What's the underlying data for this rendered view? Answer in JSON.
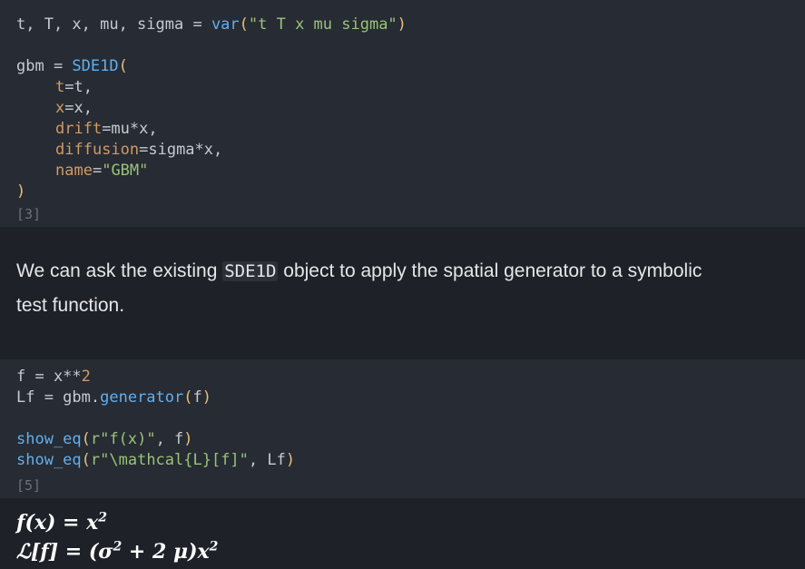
{
  "cell1": {
    "counter": "[3]",
    "line1_lhs": "t, T, x, mu, sigma = ",
    "line1_fn": "var",
    "line1_open": "(",
    "line1_str": "\"t T x mu sigma\"",
    "line1_close": ")",
    "line3_lhs": "gbm = ",
    "line3_fn": "SDE1D",
    "line3_open": "(",
    "line4_kw": "t",
    "line4_rest": "=t,",
    "line5_kw": "x",
    "line5_rest": "=x,",
    "line6_kw": "drift",
    "line6_rest": "=mu*x,",
    "line7_kw": "diffusion",
    "line7_rest": "=sigma*x,",
    "line8_kw": "name",
    "line8_eq": "=",
    "line8_str": "\"GBM\"",
    "line9_close": ")"
  },
  "markdown": {
    "text_before": "We can ask the existing ",
    "code": "SDE1D",
    "text_after": " object to apply the spatial generator to a symbolic",
    "text_line2": "test function."
  },
  "cell2": {
    "counter": "[5]",
    "line1_lhs": "f = x**",
    "line1_num": "2",
    "line2_lhs": "Lf = gbm.",
    "line2_fn": "generator",
    "line2_open": "(",
    "line2_arg": "f",
    "line2_close": ")",
    "line4_fn": "show_eq",
    "line4_open": "(",
    "line4_str": "r\"f(x)\"",
    "line4_rest": ", f",
    "line4_close": ")",
    "line5_fn": "show_eq",
    "line5_open": "(",
    "line5_str": "r\"\\mathcal{L}[f]\"",
    "line5_rest": ", Lf",
    "line5_close": ")"
  },
  "output": {
    "eq1_lhs": "f(x) = x",
    "eq1_exp": "2",
    "eq2_lhs": "ℒ[f] = (σ",
    "eq2_exp": "2",
    "eq2_mid": " + 2 μ)x",
    "eq2_exp2": "2"
  }
}
